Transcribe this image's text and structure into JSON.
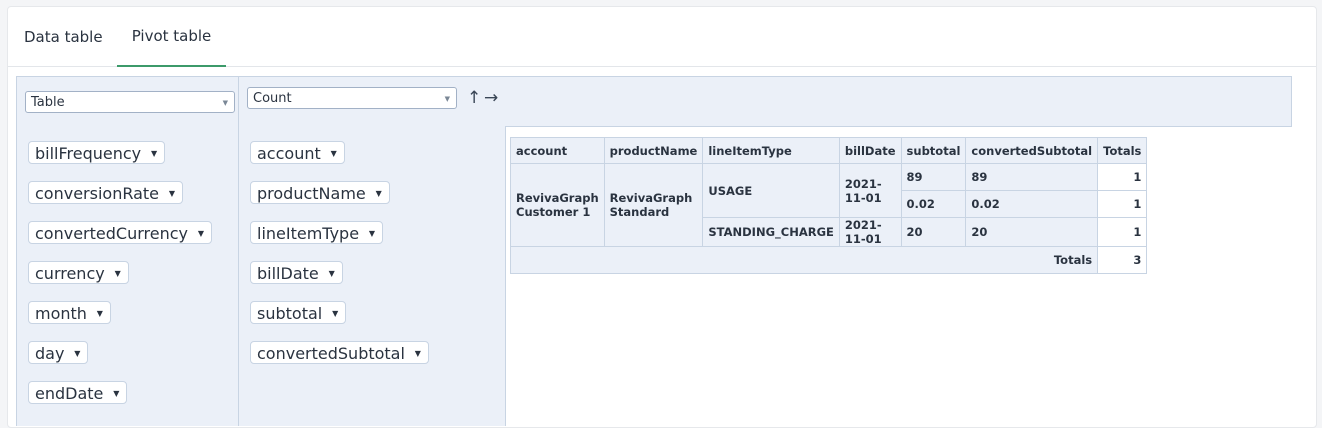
{
  "tabs": [
    {
      "label": "Data table",
      "active": false
    },
    {
      "label": "Pivot table",
      "active": true
    }
  ],
  "controls": {
    "renderer": "Table",
    "aggregator": "Count",
    "row_sort_symbol": "↕",
    "col_sort_symbol": "→",
    "row_sort_display": "↑",
    "col_sort_display": "→"
  },
  "unused_attributes": [
    "billFrequency",
    "conversionRate",
    "convertedCurrency",
    "currency",
    "month",
    "day",
    "endDate"
  ],
  "row_attributes": [
    "account",
    "productName",
    "lineItemType",
    "billDate",
    "subtotal",
    "convertedSubtotal"
  ],
  "table": {
    "headers": [
      "account",
      "productName",
      "lineItemType",
      "billDate",
      "subtotal",
      "convertedSubtotal",
      "Totals"
    ],
    "account": "RevivaGraph Customer 1",
    "productName": "RevivaGraph Standard",
    "rows": [
      {
        "lineItemType": "USAGE",
        "billDate": "2021-11-01",
        "subtotal": "89",
        "convertedSubtotal": "89",
        "total": "1"
      },
      {
        "subtotal": "0.02",
        "convertedSubtotal": "0.02",
        "total": "1"
      },
      {
        "lineItemType": "STANDING_CHARGE",
        "billDate": "2021-11-01",
        "subtotal": "20",
        "convertedSubtotal": "20",
        "total": "1"
      }
    ],
    "totals_label": "Totals",
    "grand_total": "3"
  },
  "colors": {
    "accent": "#3c9a6a",
    "panel": "#ebf0f8",
    "border": "#c8d4e3"
  }
}
